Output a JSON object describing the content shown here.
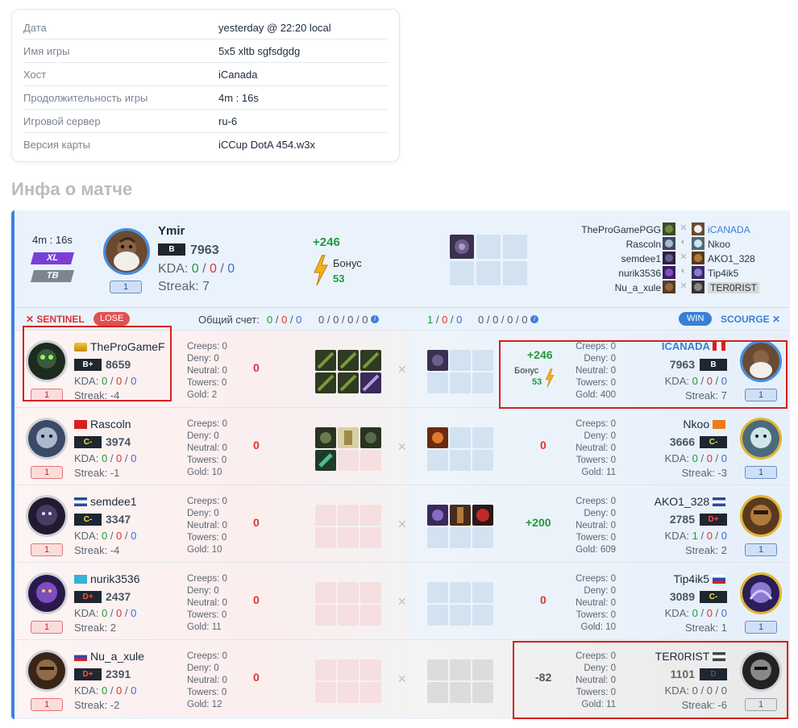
{
  "info": {
    "rows": [
      {
        "label": "Дата",
        "value": "yesterday @ 22:20 local"
      },
      {
        "label": "Имя игры",
        "value": "5x5 xltb sgfsdgdg"
      },
      {
        "label": "Хост",
        "value": "iCanada"
      },
      {
        "label": "Продолжительность игры",
        "value": "4m : 16s"
      },
      {
        "label": "Игровой сервер",
        "value": "ru-6"
      },
      {
        "label": "Версия карты",
        "value": "iCCup DotA 454.w3x"
      }
    ]
  },
  "section_title": "Инфа о матче",
  "summary": {
    "duration": "4m : 16s",
    "mode_xl": "XL",
    "mode_tb": "TB",
    "level": "1",
    "player": "Ymir",
    "rank": "B",
    "rating": "7963",
    "kda_label": "KDA:",
    "kda": [
      "0",
      "0",
      "0"
    ],
    "streak": "Streak: 7",
    "gain": "+246",
    "bonus_label": "Бонус",
    "bonus_value": "53",
    "teams": [
      {
        "left": "TheProGamePGG",
        "right": "iCANADA",
        "right_style": "blue"
      },
      {
        "left": "Rascoln",
        "right": "Nkoo",
        "right_style": ""
      },
      {
        "left": "semdee1",
        "right": "AKO1_328",
        "right_style": ""
      },
      {
        "left": "nurik3536",
        "right": "Tip4ik5",
        "right_style": ""
      },
      {
        "left": "Nu_a_xule",
        "right": "TER0RIST",
        "right_style": "grey"
      }
    ]
  },
  "header": {
    "sentinel": "SENTINEL",
    "lose": "LOSE",
    "total_label": "Общий счет:",
    "left_kda": [
      "0",
      "0",
      "0"
    ],
    "left_extra": "0 / 0 / 0 / 0",
    "right_kda": [
      "1",
      "0",
      "0"
    ],
    "right_extra": "0 / 0 / 0 / 0",
    "win": "WIN",
    "scourge": "SCOURGE"
  },
  "stat_labels": {
    "creeps": "Creeps:",
    "deny": "Deny:",
    "neutral": "Neutral:",
    "towers": "Towers:",
    "gold": "Gold:"
  },
  "rows": [
    {
      "left": {
        "name": "TheProGameF",
        "rank": "B+",
        "rating": "8659",
        "kda": [
          "0",
          "0",
          "0"
        ],
        "streak": "Streak: -4",
        "level": "1",
        "creeps": "0",
        "deny": "0",
        "neutral": "0",
        "towers": "0",
        "gold": "2",
        "score": "0"
      },
      "right": {
        "name": "ICANADA",
        "rank": "B",
        "rating": "7963",
        "kda": [
          "0",
          "0",
          "0"
        ],
        "streak": "Streak: 7",
        "level": "1",
        "creeps": "0",
        "deny": "0",
        "neutral": "0",
        "towers": "0",
        "gold": "400",
        "gain": "+246",
        "bonus_label": "Бонус",
        "bonus_value": "53"
      }
    },
    {
      "left": {
        "name": "Rascoln",
        "rank": "C-",
        "rating": "3974",
        "kda": [
          "0",
          "0",
          "0"
        ],
        "streak": "Streak: -1",
        "level": "1",
        "creeps": "0",
        "deny": "0",
        "neutral": "0",
        "towers": "0",
        "gold": "10",
        "score": "0"
      },
      "right": {
        "name": "Nkoo",
        "rank": "C-",
        "rating": "3666",
        "kda": [
          "0",
          "0",
          "0"
        ],
        "streak": "Streak: -3",
        "level": "1",
        "creeps": "0",
        "deny": "0",
        "neutral": "0",
        "towers": "0",
        "gold": "11",
        "gain": "0"
      }
    },
    {
      "left": {
        "name": "semdee1",
        "rank": "C-",
        "rating": "3347",
        "kda": [
          "0",
          "0",
          "0"
        ],
        "streak": "Streak: -4",
        "level": "1",
        "creeps": "0",
        "deny": "0",
        "neutral": "0",
        "towers": "0",
        "gold": "10",
        "score": "0"
      },
      "right": {
        "name": "AKO1_328",
        "rank": "D+",
        "rating": "2785",
        "kda": [
          "1",
          "0",
          "0"
        ],
        "streak": "Streak: 2",
        "level": "1",
        "creeps": "0",
        "deny": "0",
        "neutral": "0",
        "towers": "0",
        "gold": "609",
        "gain": "+200"
      }
    },
    {
      "left": {
        "name": "nurik3536",
        "rank": "D+",
        "rating": "2437",
        "kda": [
          "0",
          "0",
          "0"
        ],
        "streak": "Streak: 2",
        "level": "1",
        "creeps": "0",
        "deny": "0",
        "neutral": "0",
        "towers": "0",
        "gold": "11",
        "score": "0"
      },
      "right": {
        "name": "Tip4ik5",
        "rank": "C-",
        "rating": "3089",
        "kda": [
          "0",
          "0",
          "0"
        ],
        "streak": "Streak: 1",
        "level": "1",
        "creeps": "0",
        "deny": "0",
        "neutral": "0",
        "towers": "0",
        "gold": "10",
        "gain": "0"
      }
    },
    {
      "left": {
        "name": "Nu_a_xule",
        "rank": "D+",
        "rating": "2391",
        "kda": [
          "0",
          "0",
          "0"
        ],
        "streak": "Streak: -2",
        "level": "1",
        "creeps": "0",
        "deny": "0",
        "neutral": "0",
        "towers": "0",
        "gold": "12",
        "score": "0"
      },
      "right": {
        "name": "TER0RIST",
        "rank": "D",
        "rating": "1101",
        "kda": [
          "0",
          "0",
          "0"
        ],
        "streak": "Streak: -6",
        "level": "1",
        "creeps": "0",
        "deny": "0",
        "neutral": "0",
        "towers": "0",
        "gold": "11",
        "gain": "-82"
      }
    }
  ],
  "colors": {
    "accent": "#3b82e0",
    "win": "#1f9a3a",
    "lose": "#e35050",
    "highlight": "#d61f1f"
  }
}
